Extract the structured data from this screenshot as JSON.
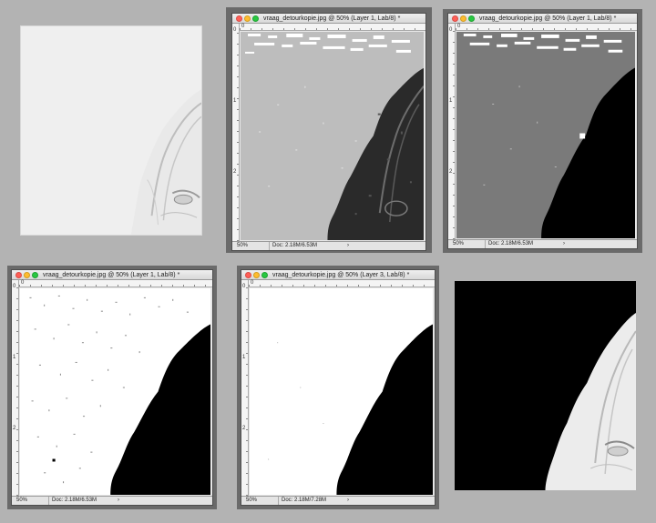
{
  "windows": {
    "top_middle": {
      "title": "vraag_detourkopie.jpg @ 50% (Layer 1, Lab/8) *",
      "zoom": "50%",
      "doc": "Doc: 2.18M/6.53M",
      "ruler_top": "0",
      "ruler_left": [
        "0",
        "1",
        "2"
      ]
    },
    "top_right": {
      "title": "vraag_detourkopie.jpg @ 50% (Layer 1, Lab/8) *",
      "zoom": "50%",
      "doc": "Doc: 2.18M/6.53M",
      "ruler_top": "0",
      "ruler_left": [
        "0",
        "1",
        "2"
      ]
    },
    "bottom_left": {
      "title": "vraag_detourkopie.jpg @ 50% (Layer 1, Lab/8) *",
      "zoom": "50%",
      "doc": "Doc: 2.18M/6.53M",
      "ruler_top": "0",
      "ruler_left": [
        "0",
        "1",
        "2"
      ]
    },
    "bottom_middle": {
      "title": "vraag_detourkopie.jpg @ 50% (Layer 3, Lab/8) *",
      "zoom": "50%",
      "doc": "Doc: 2.18M/7.28M",
      "ruler_top": "0",
      "ruler_left": [
        "0",
        "1",
        "2"
      ]
    }
  },
  "status_arrow": "›",
  "colors": {
    "page_bg": "#b3b3b3",
    "mid_gray_canvas": "#bdbdbd",
    "dark_gray_canvas": "#7a7a7a",
    "dark_region": "#1a1a1a",
    "black_region": "#000000",
    "white": "#ffffff"
  }
}
